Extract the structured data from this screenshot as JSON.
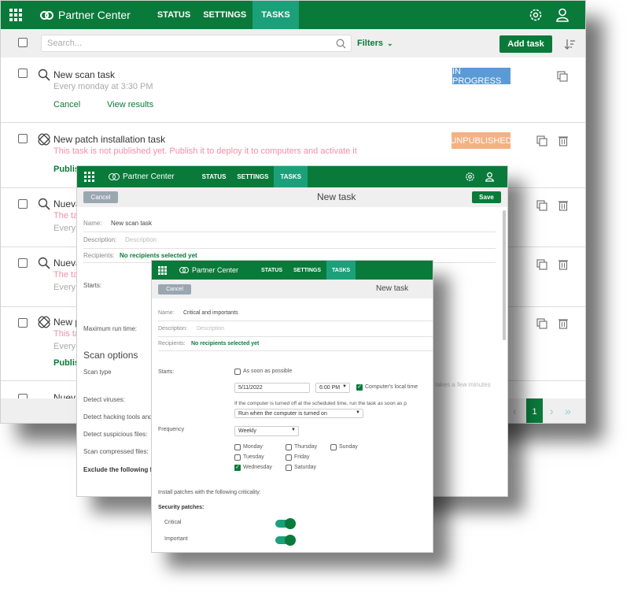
{
  "app": {
    "brand": "Partner Center",
    "nav": [
      "STATUS",
      "SETTINGS",
      "TASKS"
    ]
  },
  "list": {
    "search_placeholder": "Search...",
    "filters_label": "Filters",
    "add_task_label": "Add task",
    "rows": [
      {
        "title": "New scan task",
        "subtitle": "Every monday at 3:30 PM",
        "badge": "IN PROGRESS",
        "actions": [
          "Cancel",
          "View results"
        ]
      },
      {
        "title": "New patch installation task",
        "subtitle": "This task is not published yet. Publish it to deploy it to computers and activate it",
        "badge": "UNPUBLISHED",
        "actions": [
          "Publish"
        ]
      },
      {
        "title": "Nueva",
        "subtitle1": "The ta",
        "subtitle2": "Every"
      },
      {
        "title": "Nueva",
        "subtitle1": "The ta",
        "subtitle2": "Every"
      },
      {
        "title": "New p",
        "subtitle1": "This ta",
        "subtitle2": "Every",
        "action": "Publish"
      },
      {
        "title": "Nueva"
      }
    ],
    "pagination": {
      "current": "1"
    }
  },
  "scan_form": {
    "cancel": "Cancel",
    "heading": "New task",
    "save": "Save",
    "name_label": "Name:",
    "name_value": "New scan task",
    "description_label": "Description:",
    "description_placeholder": "Description",
    "recipients_label": "Recipients:",
    "recipients_value": "No recipients selected yet",
    "starts_label": "Starts:",
    "max_run_label": "Maximum run time:",
    "scan_options_heading": "Scan options",
    "scan_type_label": "Scan type",
    "detect_viruses": "Detect viruses:",
    "detect_hacking": "Detect hacking tools and",
    "detect_suspicious": "Detect suspicious files:",
    "scan_compressed": "Scan compressed files:",
    "exclude_label": "Exclude the following file",
    "side_note": "takes a few minutes"
  },
  "patch_form": {
    "cancel": "Cancel",
    "heading": "New task",
    "name_label": "Name:",
    "name_value": "Critical and importants",
    "description_label": "Description:",
    "description_placeholder": "Description",
    "recipients_label": "Recipients:",
    "recipients_value": "No recipients selected yet",
    "starts_label": "Starts:",
    "asap_label": "As soon as possible",
    "date_value": "5/11/2022",
    "time_value": "6:00 PM",
    "local_time_label": "Computer's local time",
    "off_note": "If the computer is turned off at the scheduled time, run the task as soon as p",
    "run_when_value": "Run when the computer is turned on",
    "frequency_label": "Frequency",
    "frequency_value": "Weekly",
    "days": [
      {
        "label": "Monday",
        "checked": false
      },
      {
        "label": "Thursday",
        "checked": false
      },
      {
        "label": "Sunday",
        "checked": false
      },
      {
        "label": "Tuesday",
        "checked": false
      },
      {
        "label": "Friday",
        "checked": false
      },
      {
        "label": "Wednesday",
        "checked": true
      },
      {
        "label": "Saturday",
        "checked": false
      }
    ],
    "criticality_label": "Install patches with the following criticality:",
    "security_label": "Security patches:",
    "critical_label": "Critical",
    "critical_on": true,
    "important_label": "Important",
    "important_on": true
  },
  "colors": {
    "green": "#0a7a3a",
    "teal": "#1ba07a",
    "in_progress": "#5b9bd5",
    "unpublished": "#f4b183",
    "pink": "#f08fa8"
  }
}
